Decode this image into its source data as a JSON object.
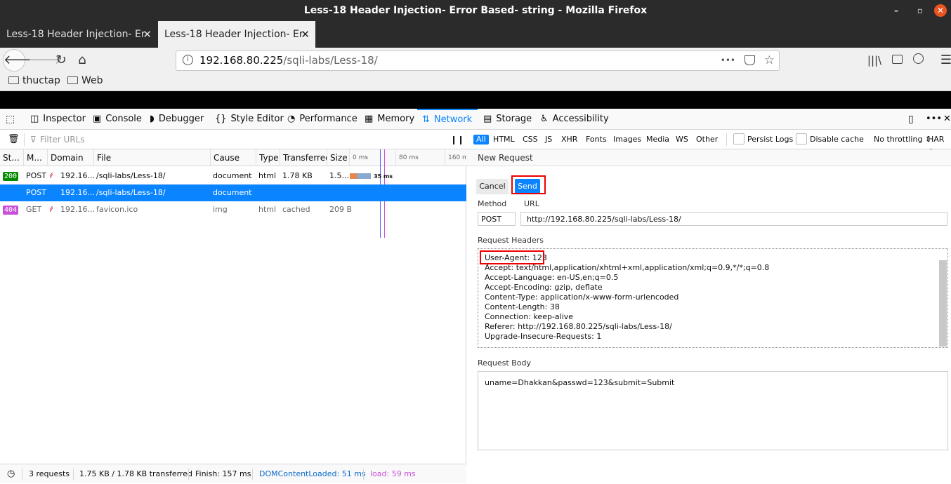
{
  "window": {
    "title": "Less-18 Header Injection- Error Based- string - Mozilla Firefox",
    "minimize": "–",
    "maximize": "▫",
    "close": "✕"
  },
  "tabs": [
    {
      "label": "Less-18 Header Injection- Er",
      "close": "✕"
    },
    {
      "label": "Less-18 Header Injection- Er",
      "close": "✕"
    }
  ],
  "newtab": "+",
  "nav": {
    "url_host": "192.168.80.225",
    "url_path": "/sqli-labs/Less-18/",
    "more": "•••"
  },
  "bookmarks": [
    {
      "label": "thuctap"
    },
    {
      "label": "Web"
    }
  ],
  "devtools": {
    "tabs": [
      {
        "label": "Inspector",
        "icon": "inspector-icon"
      },
      {
        "label": "Console",
        "icon": "console-icon"
      },
      {
        "label": "Debugger",
        "icon": "debugger-icon"
      },
      {
        "label": "Style Editor",
        "icon": "style-editor-icon"
      },
      {
        "label": "Performance",
        "icon": "performance-icon"
      },
      {
        "label": "Memory",
        "icon": "memory-icon"
      },
      {
        "label": "Network",
        "icon": "network-icon"
      },
      {
        "label": "Storage",
        "icon": "storage-icon"
      },
      {
        "label": "Accessibility",
        "icon": "accessibility-icon"
      }
    ],
    "selected_tab": "Network",
    "accent": "#0a84ff"
  },
  "network": {
    "filter_placeholder": "Filter URLs",
    "columns": [
      "St...",
      "M...",
      "Domain",
      "File",
      "Cause",
      "Type",
      "Transferred",
      "Size",
      "0 ms",
      "80 ms",
      "160 m"
    ],
    "rows": [
      {
        "status": "200",
        "method": "POST",
        "domain": "192.16...",
        "file": "/sqli-labs/Less-18/",
        "cause": "document",
        "type": "html",
        "transferred": "1.78 KB",
        "size": "1.5...",
        "timing": "35 ms",
        "selected": false
      },
      {
        "status": "",
        "method": "POST",
        "domain": "192.16...",
        "file": "/sqli-labs/Less-18/",
        "cause": "document",
        "type": "",
        "transferred": "",
        "size": "",
        "timing": "",
        "selected": true
      },
      {
        "status": "404",
        "method": "GET",
        "domain": "192.16...",
        "file": "favicon.ico",
        "cause": "img",
        "type": "html",
        "transferred": "cached",
        "size": "209 B",
        "timing": "",
        "selected": false
      }
    ],
    "status_colors": {
      "200": "#058b00",
      "404": "#c850d8"
    },
    "statusbar": {
      "requests": "3 requests",
      "transferred": "1.75 KB / 1.78 KB transferred",
      "finish": "Finish: 157 ms",
      "domcontentloaded": "DOMContentLoaded: 51 ms",
      "load": "load: 59 ms"
    }
  },
  "filters": {
    "types": [
      "All",
      "HTML",
      "CSS",
      "JS",
      "XHR",
      "Fonts",
      "Images",
      "Media",
      "WS",
      "Other"
    ],
    "persist_logs": "Persist Logs",
    "disable_cache": "Disable cache",
    "throttling": "No throttling ⇕",
    "har": "HAR ⇕"
  },
  "new_request": {
    "title": "New Request",
    "cancel": "Cancel",
    "send": "Send",
    "method_label": "Method",
    "url_label": "URL",
    "method": "POST",
    "url": "http://192.168.80.225/sqli-labs/Less-18/",
    "headers_label": "Request Headers",
    "headers": [
      "User-Agent: 123",
      "Accept: text/html,application/xhtml+xml,application/xml;q=0.9,*/*;q=0.8",
      "Accept-Language: en-US,en;q=0.5",
      "Accept-Encoding: gzip, deflate",
      "Content-Type: application/x-www-form-urlencoded",
      "Content-Length: 38",
      "Connection: keep-alive",
      "Referer: http://192.168.80.225/sqli-labs/Less-18/",
      "Upgrade-Insecure-Requests: 1"
    ],
    "body_label": "Request Body",
    "body": "uname=Dhakkan&passwd=123&submit=Submit"
  }
}
